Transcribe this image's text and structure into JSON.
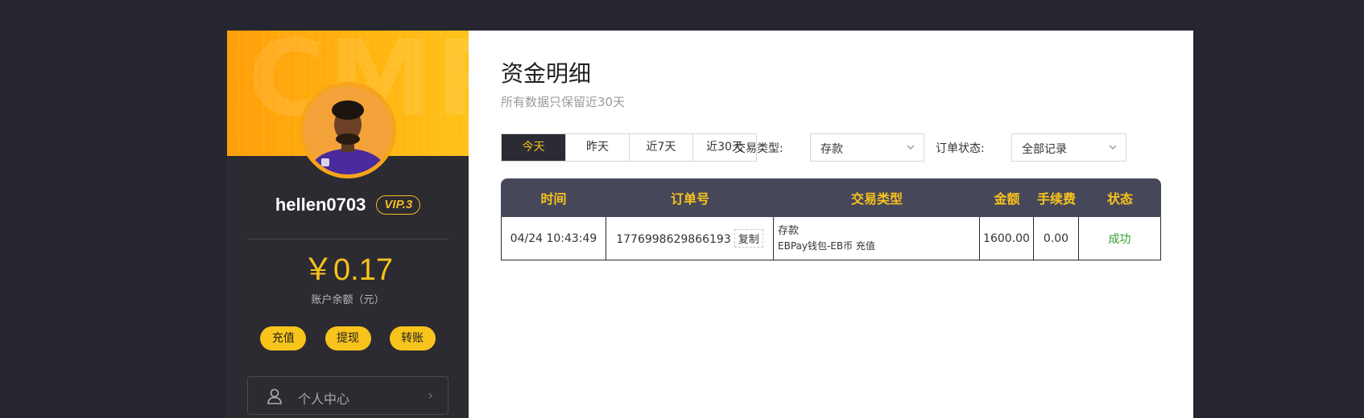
{
  "sidebar": {
    "banner_text": "CMP",
    "username": "hellen0703",
    "vip": "VIP.3",
    "balance": "￥0.17",
    "balance_label": "账户余额（元）",
    "actions": [
      "充值",
      "提现",
      "转账"
    ],
    "nav": [
      {
        "label": "个人中心",
        "icon": "person-icon"
      }
    ]
  },
  "main": {
    "title": "资金明细",
    "subtitle": "所有数据只保留近30天",
    "date_tabs": [
      "今天",
      "昨天",
      "近7天",
      "近30天"
    ],
    "active_date_tab": 0,
    "filters": {
      "type_label": "交易类型:",
      "type_value": "存款",
      "status_label": "订单状态:",
      "status_value": "全部记录"
    },
    "table": {
      "columns": [
        "时间",
        "订单号",
        "交易类型",
        "金额",
        "手续费",
        "状态"
      ],
      "rows": [
        {
          "time": "04/24 10:43:49",
          "order_no": "1776998629866193",
          "copy_label": "复制",
          "type": "存款",
          "type_detail": "EBPay钱包-EB币 充值",
          "amount": "1600.00",
          "fee": "0.00",
          "status": "成功"
        }
      ]
    }
  },
  "colors": {
    "accent": "#f8c31b",
    "sidebar_bg": "#2b2b31",
    "page_bg": "#262630",
    "header_bg": "#47475a",
    "success": "#2f9e2f"
  }
}
